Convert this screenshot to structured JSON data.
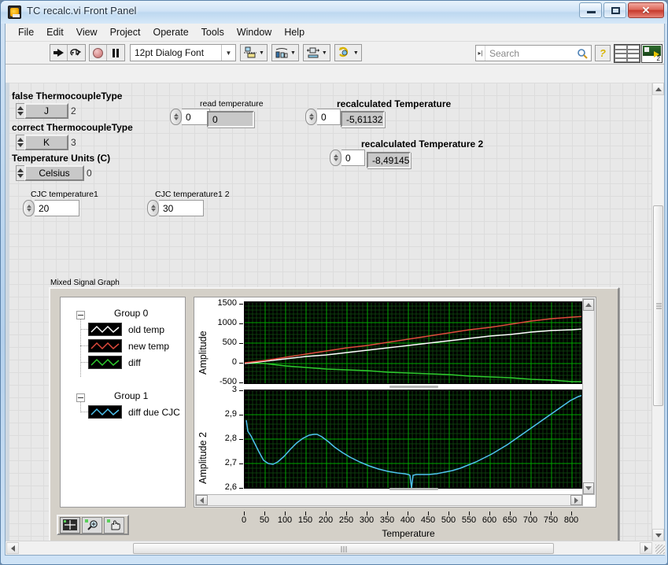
{
  "window": {
    "title": "TC recalc.vi Front Panel",
    "icon": "labview-vi-icon",
    "minimize_label": "–",
    "maximize_label": "□",
    "close_label": "✕"
  },
  "menubar": {
    "items": [
      "File",
      "Edit",
      "View",
      "Project",
      "Operate",
      "Tools",
      "Window",
      "Help"
    ]
  },
  "toolbar": {
    "run_label": "run-arrow",
    "run_continuous_label": "run-continuously",
    "abort_label": "abort-execution",
    "pause_label": "pause",
    "font_selector": "12pt Dialog Font",
    "align_objects": "align-objects",
    "distribute_objects": "distribute-objects",
    "resize_objects": "resize-objects",
    "reorder_objects": "reorder-objects",
    "caret": "▾",
    "search_placeholder": "Search",
    "help_label": "?",
    "vi_icon_number": "2"
  },
  "controls": {
    "thermocouple_false": {
      "label": "false ThermocoupleType",
      "value": "J",
      "index": "2"
    },
    "thermocouple_correct": {
      "label": "correct ThermocoupleType",
      "value": "K",
      "index": "3"
    },
    "temperature_units": {
      "label": "Temperature Units (C)",
      "value": "Celsius",
      "index": "0"
    },
    "read_temperature": {
      "label": "read temperature",
      "spinner_value": "0",
      "value": "0"
    },
    "recalculated_temperature": {
      "label": "recalculated Temperature",
      "spinner_value": "0",
      "value": "-5,61132"
    },
    "recalculated_temperature_2": {
      "label": "recalculated Temperature 2",
      "spinner_value": "0",
      "value": "-8,49145"
    },
    "cjc_temperature_1": {
      "label": "CJC temperature1",
      "value": "20"
    },
    "cjc_temperature_1_2": {
      "label": "CJC temperature1 2",
      "value": "30"
    }
  },
  "graph": {
    "label": "Mixed Signal Graph",
    "legend": {
      "groups": [
        {
          "name": "Group 0",
          "expander": "collapse-icon",
          "plots": [
            {
              "name": "old temp",
              "color": "#ffffff"
            },
            {
              "name": "new temp",
              "color": "#e04a3c"
            },
            {
              "name": "diff",
              "color": "#2ecc2e"
            }
          ]
        },
        {
          "name": "Group 1",
          "expander": "collapse-icon",
          "plots": [
            {
              "name": "diff due CJC",
              "color": "#4ec3ef"
            }
          ]
        }
      ]
    },
    "palette": {
      "cursor_tool": "cursor-crosshair-icon",
      "zoom_tool": "zoom-magnifier-icon",
      "pan_tool": "pan-hand-icon"
    }
  },
  "chart_data": [
    {
      "type": "line",
      "title": "Mixed Signal Graph",
      "plot_index": 0,
      "ylabel": "Amplitude",
      "xlabel": "Temperature",
      "yticks": [
        "1500",
        "1000",
        "500",
        "0",
        "-500"
      ],
      "ylim": [
        -500,
        1500
      ],
      "xlim": [
        0,
        820
      ],
      "grid": true,
      "background": "#000000",
      "gridcolor": "#00a000",
      "legend_position": "left-pane",
      "series": [
        {
          "name": "old temp",
          "color": "#ffffff",
          "x": [
            0,
            50,
            100,
            150,
            200,
            250,
            300,
            350,
            400,
            450,
            500,
            550,
            600,
            650,
            700,
            750,
            800
          ],
          "y": [
            0,
            50,
            105,
            160,
            215,
            270,
            325,
            380,
            435,
            490,
            545,
            600,
            655,
            700,
            745,
            780,
            810
          ]
        },
        {
          "name": "new temp",
          "color": "#e04a3c",
          "x": [
            0,
            50,
            100,
            150,
            200,
            250,
            300,
            350,
            400,
            450,
            500,
            550,
            600,
            650,
            700,
            750,
            800
          ],
          "y": [
            10,
            80,
            150,
            220,
            290,
            360,
            430,
            500,
            570,
            640,
            710,
            780,
            850,
            920,
            990,
            1050,
            1105
          ]
        },
        {
          "name": "diff",
          "color": "#2ecc2e",
          "x": [
            0,
            50,
            100,
            150,
            200,
            250,
            300,
            350,
            400,
            450,
            500,
            550,
            600,
            650,
            700,
            750,
            800
          ],
          "y": [
            10,
            5,
            -35,
            -60,
            -85,
            -95,
            -110,
            -130,
            -150,
            -160,
            -175,
            -195,
            -215,
            -230,
            -250,
            -265,
            -295
          ]
        }
      ]
    },
    {
      "type": "line",
      "plot_index": 1,
      "ylabel": "Amplitude 2",
      "xlabel": "Temperature",
      "yticks": [
        "3",
        "2,9",
        "2,8",
        "2,7",
        "2,6"
      ],
      "ylim": [
        2.6,
        3.0
      ],
      "xlim": [
        0,
        820
      ],
      "grid": true,
      "background": "#000000",
      "gridcolor": "#00a000",
      "series": [
        {
          "name": "diff due CJC",
          "color": "#4ec3ef",
          "x": [
            0,
            10,
            25,
            50,
            75,
            100,
            125,
            150,
            175,
            200,
            250,
            300,
            350,
            380,
            395,
            400,
            420,
            450,
            500,
            550,
            600,
            650,
            700,
            750,
            800,
            820
          ],
          "y": [
            2.879,
            2.824,
            2.768,
            2.701,
            2.706,
            2.745,
            2.792,
            2.81,
            2.8,
            2.775,
            2.718,
            2.676,
            2.651,
            2.646,
            2.6,
            2.641,
            2.641,
            2.643,
            2.661,
            2.695,
            2.74,
            2.795,
            2.855,
            2.915,
            2.97,
            2.98
          ]
        }
      ]
    }
  ],
  "xaxis": {
    "label": "Temperature",
    "ticks": [
      "0",
      "50",
      "100",
      "150",
      "200",
      "250",
      "300",
      "350",
      "400",
      "450",
      "500",
      "550",
      "600",
      "650",
      "700",
      "750",
      "800"
    ]
  },
  "colors": {
    "plot_background": "#000000",
    "grid_major": "#00a800",
    "grid_minor": "#0d3d0d",
    "panel_background": "#e8e8e8",
    "accent_close": "#c6392c"
  }
}
